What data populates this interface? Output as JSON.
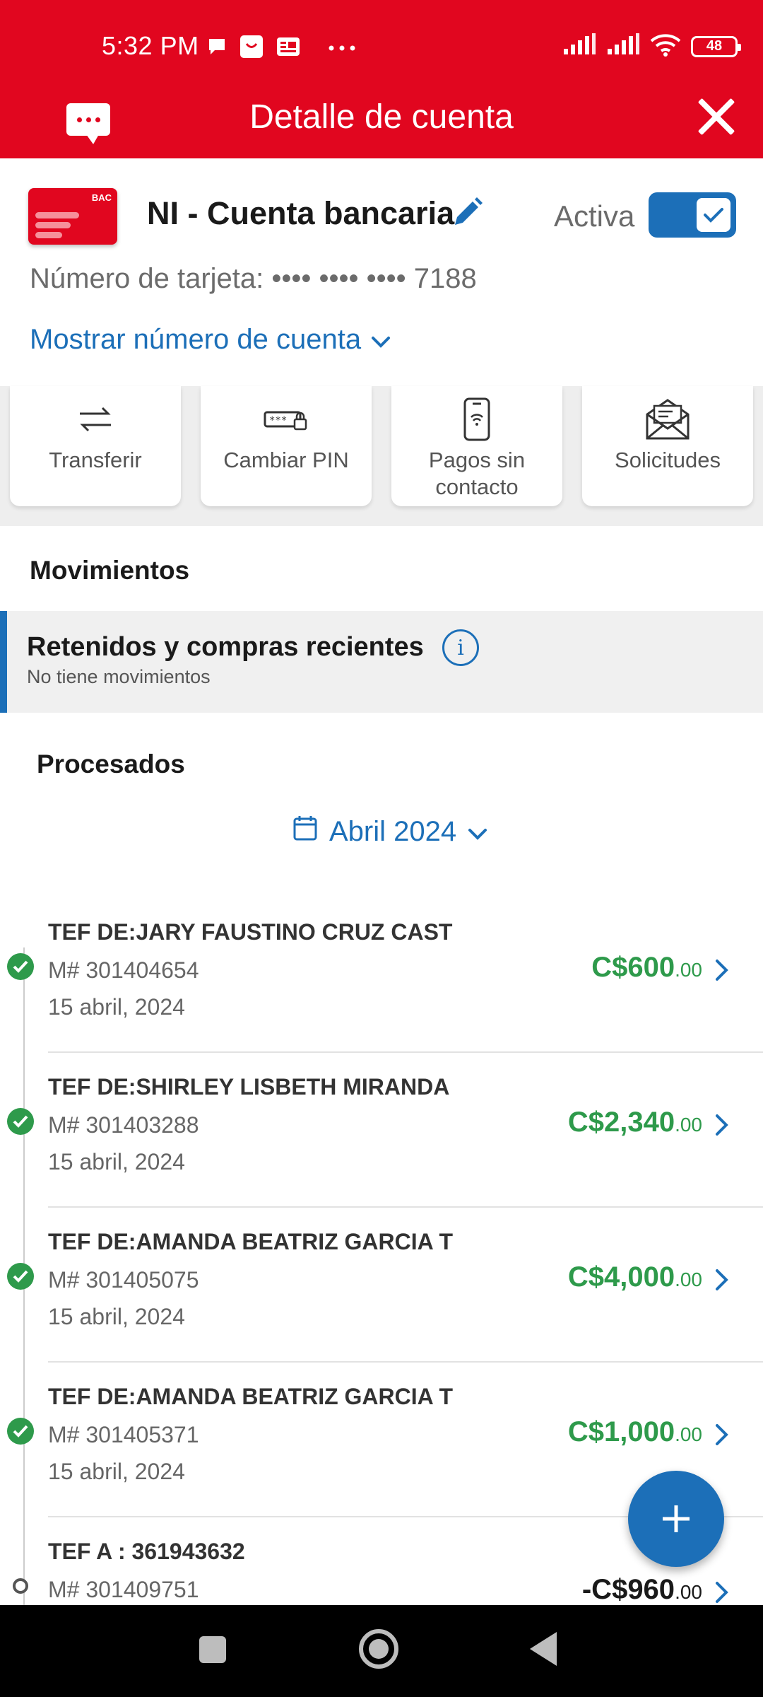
{
  "status_bar": {
    "time": "5:32 PM",
    "battery": "48",
    "icons": [
      "chat-bubble-icon",
      "notification-app-icon",
      "news-app-icon",
      "more-dots-icon",
      "signal-icon",
      "signal-icon",
      "wifi-icon",
      "battery-icon"
    ]
  },
  "header": {
    "title": "Detalle de cuenta"
  },
  "account": {
    "name": "NI - Cuenta bancaria",
    "status_label": "Activa",
    "active": true,
    "card_number_label": "Número de tarjeta:",
    "card_number_masked": "•••• •••• •••• 7188",
    "show_account_link": "Mostrar número de cuenta",
    "card_logo": "BAC"
  },
  "actions": [
    {
      "label": "Transferir",
      "icon": "transfer-arrows-icon"
    },
    {
      "label": "Cambiar PIN",
      "icon": "pin-lock-icon"
    },
    {
      "label": "Pagos sin contacto",
      "icon": "contactless-phone-icon"
    },
    {
      "label": "Solicitudes",
      "icon": "envelope-icon"
    }
  ],
  "movements": {
    "title": "Movimientos",
    "held": {
      "title": "Retenidos y compras recientes",
      "subtitle": "No tiene movimientos"
    },
    "processed_title": "Procesados",
    "month": "Abril 2024",
    "transactions": [
      {
        "description": "TEF DE:JARY FAUSTINO CRUZ CAST",
        "reference": "M# 301404654",
        "date": "15 abril, 2024",
        "amount_main": "C$600",
        "amount_cents": ".00",
        "status": "completed"
      },
      {
        "description": "TEF DE:SHIRLEY LISBETH MIRANDA",
        "reference": "M# 301403288",
        "date": "15 abril, 2024",
        "amount_main": "C$2,340",
        "amount_cents": ".00",
        "status": "completed"
      },
      {
        "description": "TEF DE:AMANDA BEATRIZ GARCIA T",
        "reference": "M# 301405075",
        "date": "15 abril, 2024",
        "amount_main": "C$4,000",
        "amount_cents": ".00",
        "status": "completed"
      },
      {
        "description": "TEF DE:AMANDA BEATRIZ GARCIA T",
        "reference": "M# 301405371",
        "date": "15 abril, 2024",
        "amount_main": "C$1,000",
        "amount_cents": ".00",
        "status": "completed"
      },
      {
        "description": "TEF A : 361943632",
        "reference": "M# 301409751",
        "date": "",
        "amount_main": "-C$960",
        "amount_cents": ".00",
        "status": "pending"
      }
    ]
  },
  "colors": {
    "brand_red": "#e1061f",
    "link_blue": "#1c6fb8",
    "credit_green": "#2e9a4b"
  }
}
